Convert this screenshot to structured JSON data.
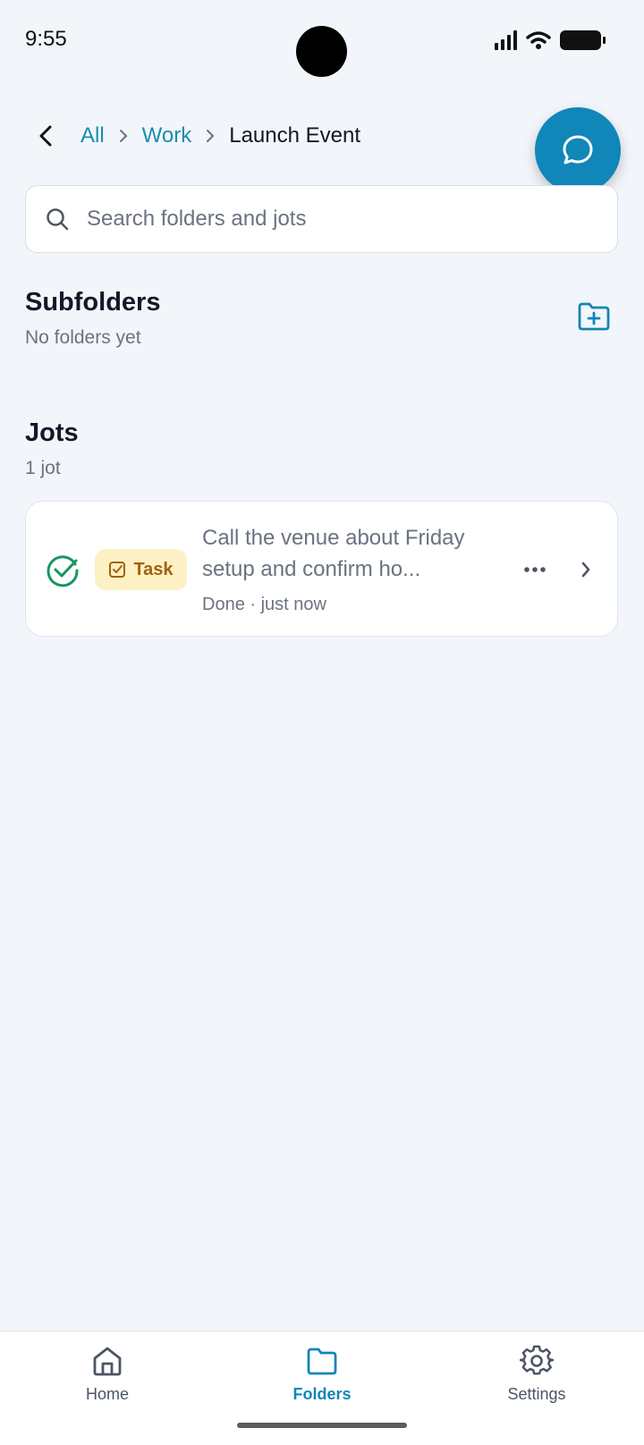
{
  "status_bar": {
    "time": "9:55"
  },
  "breadcrumb": {
    "root": "All",
    "parent": "Work",
    "current": "Launch Event"
  },
  "search": {
    "placeholder": "Search folders and jots",
    "value": ""
  },
  "subfolders": {
    "title": "Subfolders",
    "subtitle": "No folders yet"
  },
  "jots": {
    "title": "Jots",
    "count": "1 jot",
    "items": [
      {
        "type_label": "Task",
        "title": "Call the venue about Friday setup and confirm ho...",
        "meta": "Done · just now",
        "status": "done"
      }
    ]
  },
  "nav": {
    "items": [
      {
        "label": "Home",
        "icon": "home-icon"
      },
      {
        "label": "Folders",
        "icon": "folder-icon",
        "active": true
      },
      {
        "label": "Settings",
        "icon": "gear-icon"
      }
    ]
  },
  "colors": {
    "accent": "#1186b8",
    "link": "#1a8cb0",
    "done": "#15965f",
    "task_badge_bg": "#fdf0c4",
    "task_badge_text": "#a1620b"
  }
}
